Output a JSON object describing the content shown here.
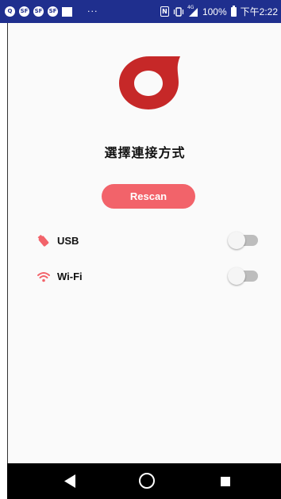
{
  "status_bar": {
    "notification_icons": [
      "Q",
      "SF",
      "SF",
      "SF"
    ],
    "overflow": "···",
    "signal_label": "4G",
    "battery": "100%",
    "time": "下午2:22"
  },
  "app": {
    "title": "選擇連接方式",
    "rescan_label": "Rescan",
    "connections": [
      {
        "label": "USB",
        "icon": "usb-icon",
        "enabled": false
      },
      {
        "label": "Wi-Fi",
        "icon": "wifi-icon",
        "enabled": false
      }
    ]
  },
  "colors": {
    "status_bar": "#1f2f8e",
    "accent": "#f2636a",
    "logo": "#c62828"
  },
  "nav_bar": {
    "buttons": [
      "back-icon",
      "home-icon",
      "recents-icon"
    ]
  }
}
